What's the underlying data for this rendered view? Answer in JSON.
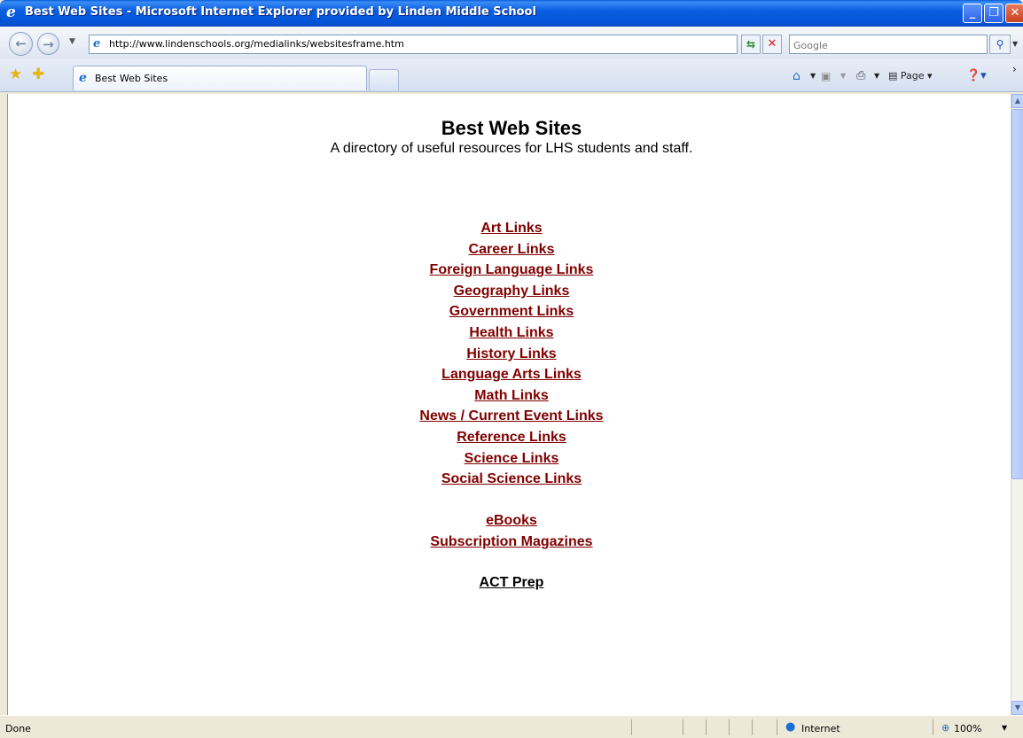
{
  "window": {
    "title": "Best Web Sites - Microsoft Internet Explorer provided by Linden Middle School",
    "minimize_glyph": "_",
    "maximize_glyph": "❐",
    "close_glyph": "✕"
  },
  "address_bar": {
    "url": "http://www.lindenschools.org/medialinks/websitesframe.htm"
  },
  "search": {
    "placeholder": "Google"
  },
  "tabs": [
    {
      "label": "Best Web Sites",
      "active": true
    }
  ],
  "command_bar": {
    "page_label": "Page"
  },
  "page": {
    "heading": "Best Web Sites",
    "subtitle": "A directory of useful resources for LHS students and staff.",
    "link_color": "#800000",
    "subject_links": [
      "Art Links",
      "Career Links",
      "Foreign Language Links",
      "Geography Links",
      "Government Links",
      "Health Links",
      "History Links",
      "Language Arts Links",
      "Math Links",
      "News / Current Event Links",
      "Reference Links",
      "Science Links",
      "Social Science Links"
    ],
    "extra_links": [
      "eBooks",
      "Subscription Magazines"
    ],
    "act_link": "ACT Prep"
  },
  "status_bar": {
    "status": "Done",
    "zone": "Internet",
    "zoom": "100%"
  },
  "icons": {
    "back": "back-arrow-icon",
    "forward": "forward-arrow-icon",
    "refresh": "refresh-icon",
    "stop": "stop-icon",
    "search": "search-icon",
    "favorites": "favorites-star-icon",
    "add_favorites": "add-favorites-icon",
    "home": "home-icon",
    "feeds": "feeds-icon",
    "print": "print-icon",
    "help": "help-icon",
    "zone": "globe-icon",
    "zoom": "zoom-icon"
  }
}
